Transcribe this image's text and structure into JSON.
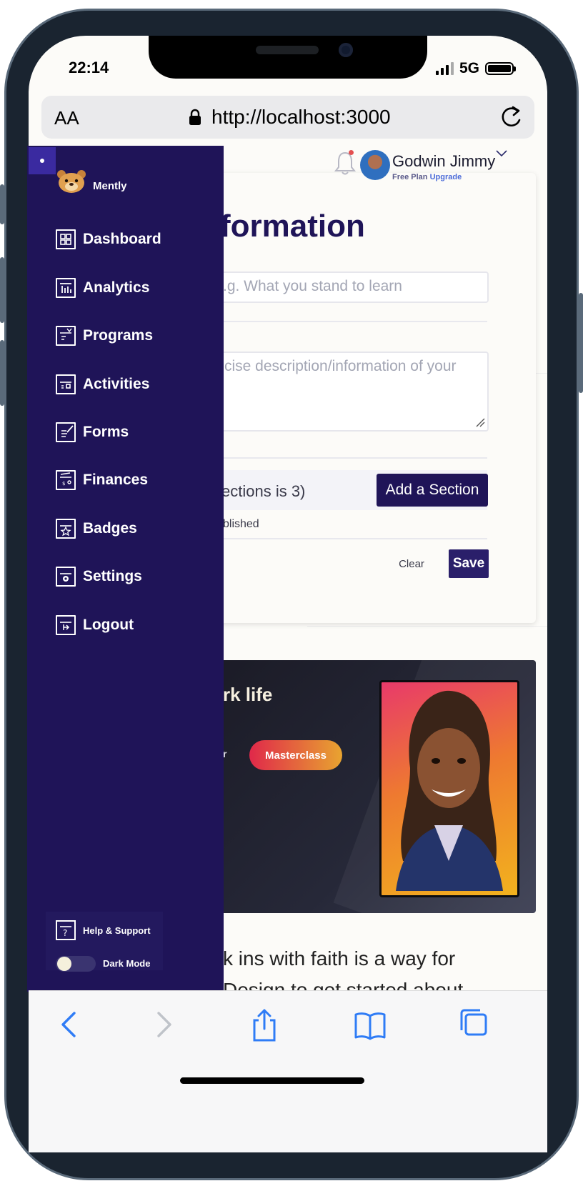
{
  "status_bar": {
    "time": "22:14",
    "network": "5G"
  },
  "browser": {
    "text_size_label": "AA",
    "url": "http://localhost:3000",
    "lock_icon": "lock-icon",
    "reload_icon": "reload-icon"
  },
  "header": {
    "user_name": "Godwin Jimmy",
    "plan": "Free Plan",
    "upgrade": "Upgrade",
    "notification_icon": "bell-icon"
  },
  "form": {
    "heading": "formation",
    "title_placeholder": ".g. What you stand to learn",
    "description_placeholder": "cise description/information of your",
    "sections_text": "ections is 3)",
    "add_section_label": "Add a Section",
    "published_text": "blished",
    "clear_label": "Clear",
    "save_label": "Save"
  },
  "promo": {
    "title": "rk life",
    "small_text": "r",
    "pill_label": "Masterclass"
  },
  "article": {
    "line1": "k ins with faith is a way for",
    "line2": "Design to get started about"
  },
  "sidebar": {
    "logo_text": "Mently",
    "items": [
      {
        "label": "Dashboard",
        "icon": "dashboard-icon"
      },
      {
        "label": "Analytics",
        "icon": "analytics-icon"
      },
      {
        "label": "Programs",
        "icon": "programs-icon"
      },
      {
        "label": "Activities",
        "icon": "activities-icon"
      },
      {
        "label": "Forms",
        "icon": "forms-icon"
      },
      {
        "label": "Finances",
        "icon": "finances-icon"
      },
      {
        "label": "Badges",
        "icon": "badges-icon"
      },
      {
        "label": "Settings",
        "icon": "settings-icon"
      },
      {
        "label": "Logout",
        "icon": "logout-icon"
      }
    ],
    "help_label": "Help & Support",
    "dark_mode_label": "Dark Mode",
    "dark_mode_on": false
  },
  "browser_toolbar": {
    "icons": [
      "back-icon",
      "forward-icon",
      "share-icon",
      "bookmarks-icon",
      "tabs-icon"
    ]
  },
  "colors": {
    "sidebar": "#1f1458",
    "primary": "#1f1458",
    "accent_pill_start": "#e0284a",
    "accent_pill_end": "#e8a430",
    "link": "#4a6ad8",
    "ios_blue": "#2f7cf6"
  }
}
